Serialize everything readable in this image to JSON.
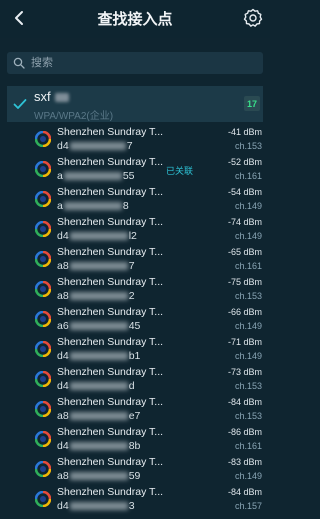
{
  "header": {
    "title": "查找接入点",
    "back_icon": "chevron-left-icon",
    "settings_icon": "settings-gear-icon"
  },
  "search": {
    "placeholder": "搜索"
  },
  "current_network": {
    "ssid": "sxf",
    "security": "WPA/WPA2(企业)",
    "ap_count": "17",
    "check_color": "#2ec3d6"
  },
  "access_points": [
    {
      "name": "Shenzhen Sundray T...",
      "mac": "d4",
      "mac_tail": "7",
      "status": "",
      "signal": "-41 dBm",
      "channel": "ch.153"
    },
    {
      "name": "Shenzhen Sundray T...",
      "mac": "a",
      "mac_tail": "55",
      "status": "已关联",
      "signal": "-52 dBm",
      "channel": "ch.161"
    },
    {
      "name": "Shenzhen Sundray T...",
      "mac": "a",
      "mac_tail": "8",
      "status": "",
      "signal": "-54 dBm",
      "channel": "ch.149"
    },
    {
      "name": "Shenzhen Sundray T...",
      "mac": "d4",
      "mac_tail": "l2",
      "status": "",
      "signal": "-74 dBm",
      "channel": "ch.149"
    },
    {
      "name": "Shenzhen Sundray T...",
      "mac": "a8",
      "mac_tail": "7",
      "status": "",
      "signal": "-65 dBm",
      "channel": "ch.161"
    },
    {
      "name": "Shenzhen Sundray T...",
      "mac": "a8",
      "mac_tail": "2",
      "status": "",
      "signal": "-75 dBm",
      "channel": "ch.153"
    },
    {
      "name": "Shenzhen Sundray T...",
      "mac": "a6",
      "mac_tail": "45",
      "status": "",
      "signal": "-66 dBm",
      "channel": "ch.149"
    },
    {
      "name": "Shenzhen Sundray T...",
      "mac": "d4",
      "mac_tail": "b1",
      "status": "",
      "signal": "-71 dBm",
      "channel": "ch.149"
    },
    {
      "name": "Shenzhen Sundray T...",
      "mac": "d4",
      "mac_tail": "d",
      "status": "",
      "signal": "-73 dBm",
      "channel": "ch.153"
    },
    {
      "name": "Shenzhen Sundray T...",
      "mac": "a8",
      "mac_tail": "e7",
      "status": "",
      "signal": "-84 dBm",
      "channel": "ch.153"
    },
    {
      "name": "Shenzhen Sundray T...",
      "mac": "d4",
      "mac_tail": "8b",
      "status": "",
      "signal": "-86 dBm",
      "channel": "ch.161"
    },
    {
      "name": "Shenzhen Sundray T...",
      "mac": "a8",
      "mac_tail": "59",
      "status": "",
      "signal": "-83 dBm",
      "channel": "ch.149"
    },
    {
      "name": "Shenzhen Sundray T...",
      "mac": "d4",
      "mac_tail": "3",
      "status": "",
      "signal": "-84 dBm",
      "channel": "ch.157"
    }
  ]
}
